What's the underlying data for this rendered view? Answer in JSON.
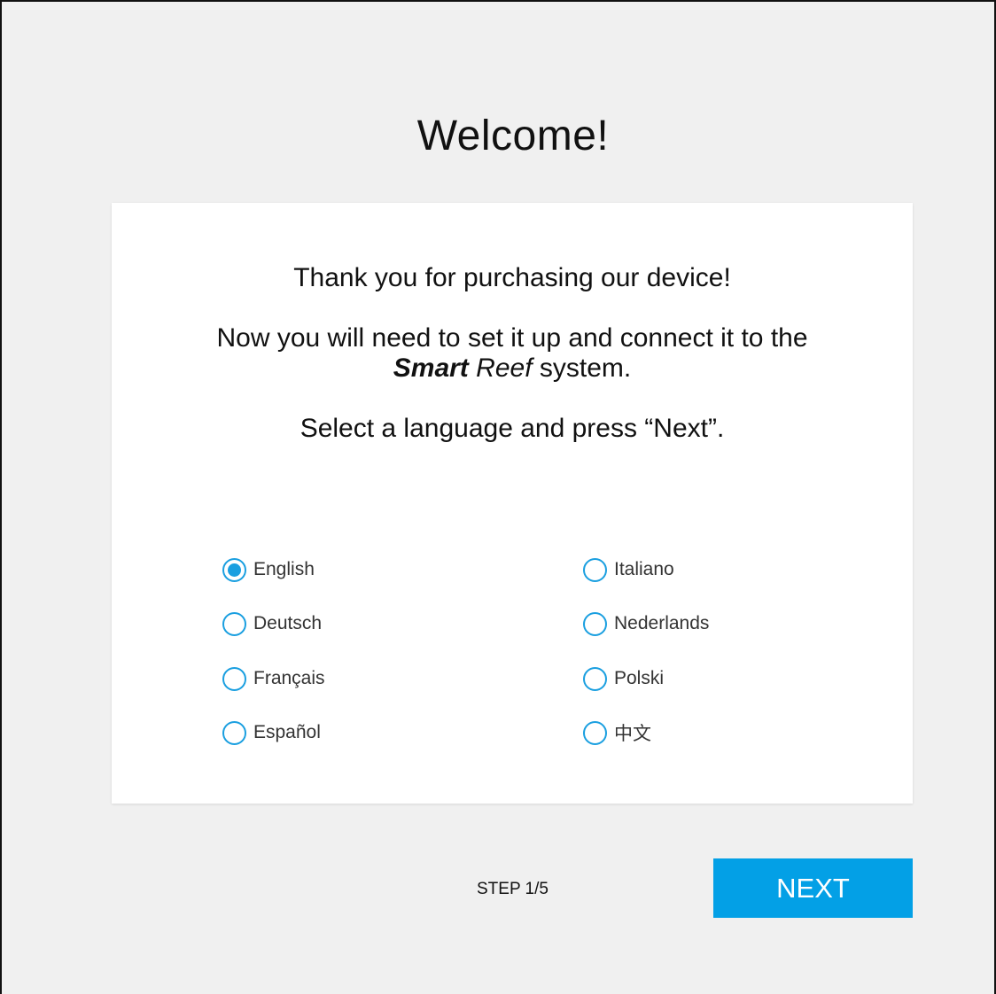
{
  "page": {
    "title": "Welcome!"
  },
  "card": {
    "line1": "Thank you for purchasing our device!",
    "line2": "Now you will need to set it up and connect it to the",
    "brand_smart": "Smart",
    "brand_reef": "Reef",
    "line3_suffix": "system.",
    "line4": "Select a language and press “Next”."
  },
  "languages": {
    "selected": "English",
    "options": [
      {
        "label": "English",
        "checked": true
      },
      {
        "label": "Deutsch",
        "checked": false
      },
      {
        "label": "Français",
        "checked": false
      },
      {
        "label": "Español",
        "checked": false
      },
      {
        "label": "Italiano",
        "checked": false
      },
      {
        "label": "Nederlands",
        "checked": false
      },
      {
        "label": "Polski",
        "checked": false
      },
      {
        "label": "中文",
        "checked": false
      }
    ]
  },
  "footer": {
    "step": "STEP 1/5",
    "next_label": "NEXT"
  },
  "colors": {
    "accent": "#03a0e6",
    "radio": "#1a9fe0",
    "background": "#f0f0f0",
    "card": "#ffffff"
  }
}
